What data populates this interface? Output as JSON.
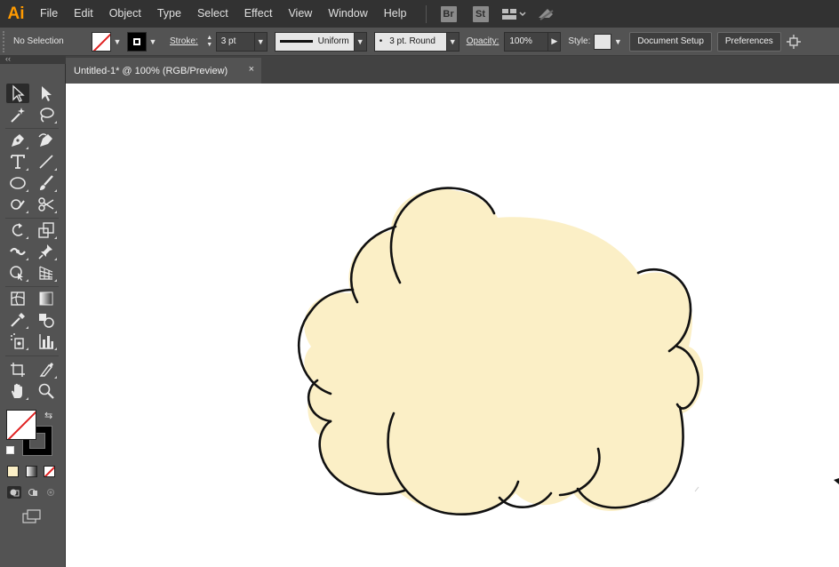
{
  "app": {
    "logo": "Ai"
  },
  "menu": [
    "File",
    "Edit",
    "Object",
    "Type",
    "Select",
    "Effect",
    "View",
    "Window",
    "Help"
  ],
  "menubar_badges": {
    "bridge": "Br",
    "stock": "St"
  },
  "controlbar": {
    "selection_status": "No Selection",
    "stroke_label": "Stroke:",
    "stroke_weight": "3 pt",
    "profile": "Uniform",
    "brush": "3 pt. Round",
    "brush_dot": "•",
    "opacity_label": "Opacity:",
    "opacity": "100%",
    "style_label": "Style:",
    "document_setup": "Document Setup",
    "preferences": "Preferences"
  },
  "document_tab": {
    "title": "Untitled-1* @ 100% (RGB/Preview)",
    "close": "×"
  },
  "toolbar": {
    "tools": [
      "selection-tool",
      "direct-selection-tool",
      "magic-wand-tool",
      "lasso-tool",
      "pen-tool",
      "curvature-tool",
      "type-tool",
      "line-segment-tool",
      "ellipse-tool",
      "paintbrush-tool",
      "shaper-tool",
      "scissors-tool",
      "rotate-tool",
      "scale-tool",
      "width-tool",
      "puppet-warp-tool",
      "shape-builder-tool",
      "perspective-grid-tool",
      "mesh-tool",
      "gradient-tool",
      "eyedropper-tool",
      "blend-tool",
      "symbol-sprayer-tool",
      "column-graph-tool",
      "artboard-tool",
      "slice-tool",
      "hand-tool",
      "zoom-tool"
    ]
  },
  "colors": {
    "cloud_fill": "#fbefc6",
    "cloud_stroke": "#111111",
    "app_accent": "#ff9a00"
  }
}
